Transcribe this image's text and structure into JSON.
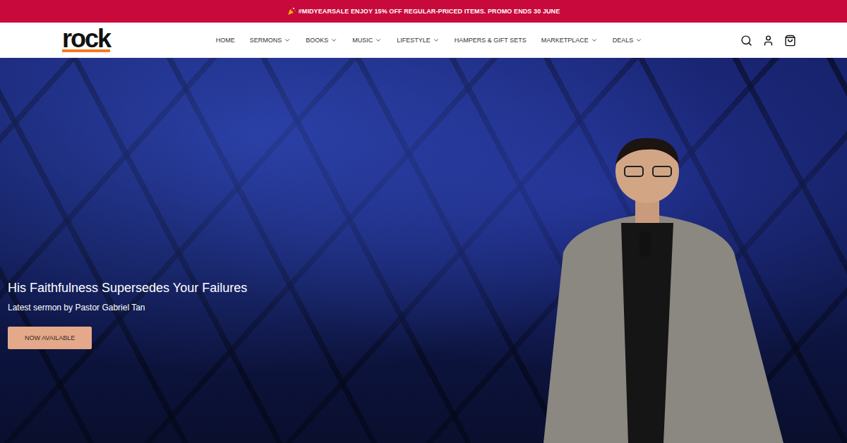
{
  "promo_bar": {
    "text": "#MIDYEARSALE ENJOY 15% OFF REGULAR-PRICED ITEMS. PROMO ENDS 30 JUNE"
  },
  "header": {
    "logo": "rock",
    "nav": [
      {
        "label": "HOME",
        "dropdown": false
      },
      {
        "label": "SERMONS",
        "dropdown": true
      },
      {
        "label": "BOOKS",
        "dropdown": true
      },
      {
        "label": "MUSIC",
        "dropdown": true
      },
      {
        "label": "LIFESTYLE",
        "dropdown": true
      },
      {
        "label": "HAMPERS & GIFT SETS",
        "dropdown": false
      },
      {
        "label": "MARKETPLACE",
        "dropdown": true
      },
      {
        "label": "DEALS",
        "dropdown": true
      }
    ]
  },
  "hero": {
    "title": "His Faithfulness Supersedes Your Failures",
    "subtitle": "Latest sermon by Pastor Gabriel Tan",
    "button": "NOW AVAILABLE"
  }
}
